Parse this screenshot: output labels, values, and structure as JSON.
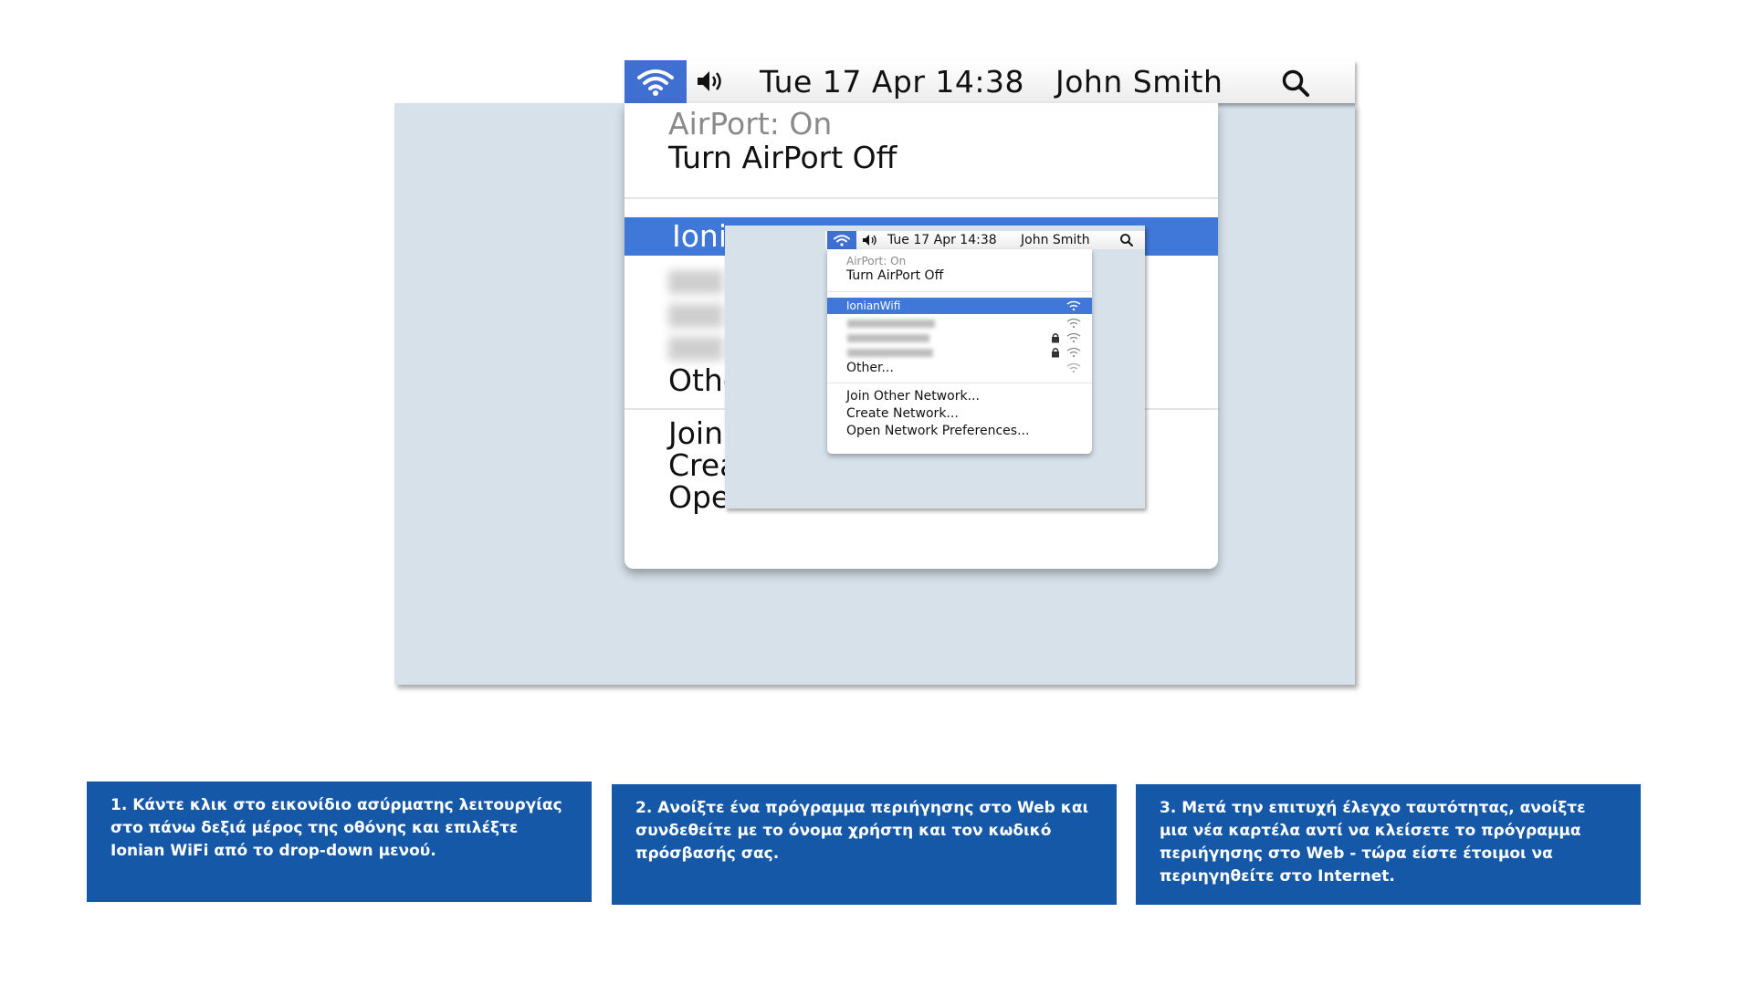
{
  "menubar": {
    "clock": "Tue 17 Apr  14:38",
    "user": "John Smith",
    "icons": [
      "wifi-icon",
      "speaker-icon",
      "search-icon"
    ]
  },
  "menu": {
    "airport_status": "AirPort: On",
    "turn_off": "Turn AirPort Off",
    "selected_network": "IonianWifi",
    "other": "Other...",
    "join_other": "Join Other Network...",
    "create_network": "Create Network...",
    "open_prefs": "Open Network Preferences..."
  },
  "big_menu_cropped": {
    "selected_network": "Ionia",
    "other": "Othe",
    "join_other": "Join",
    "create_network": "Crea"
  },
  "colors": {
    "selection_blue": "#3f78d8",
    "step_box_blue": "#1558a8",
    "desktop": "#d6e1ea"
  },
  "steps": [
    {
      "text": "1. Κάντε κλικ στο εικονίδιο ασύρματης λειτουργίας στο πάνω δεξιά μέρος της οθόνης και επιλέξτε Ionian WiFi από το drop-down μενού."
    },
    {
      "text": "2. Ανοίξτε ένα πρόγραμμα περιήγησης στο Web και συνδεθείτε με το όνομα χρήστη και τον κωδικό πρόσβασής σας."
    },
    {
      "text": "3. Μετά την επιτυχή έλεγχο ταυτότητας, ανοίξτε μια νέα καρτέλα αντί να κλείσετε το πρόγραμμα περιήγησης στο Web - τώρα είστε έτοιμοι να περιηγηθείτε στο Internet."
    }
  ]
}
